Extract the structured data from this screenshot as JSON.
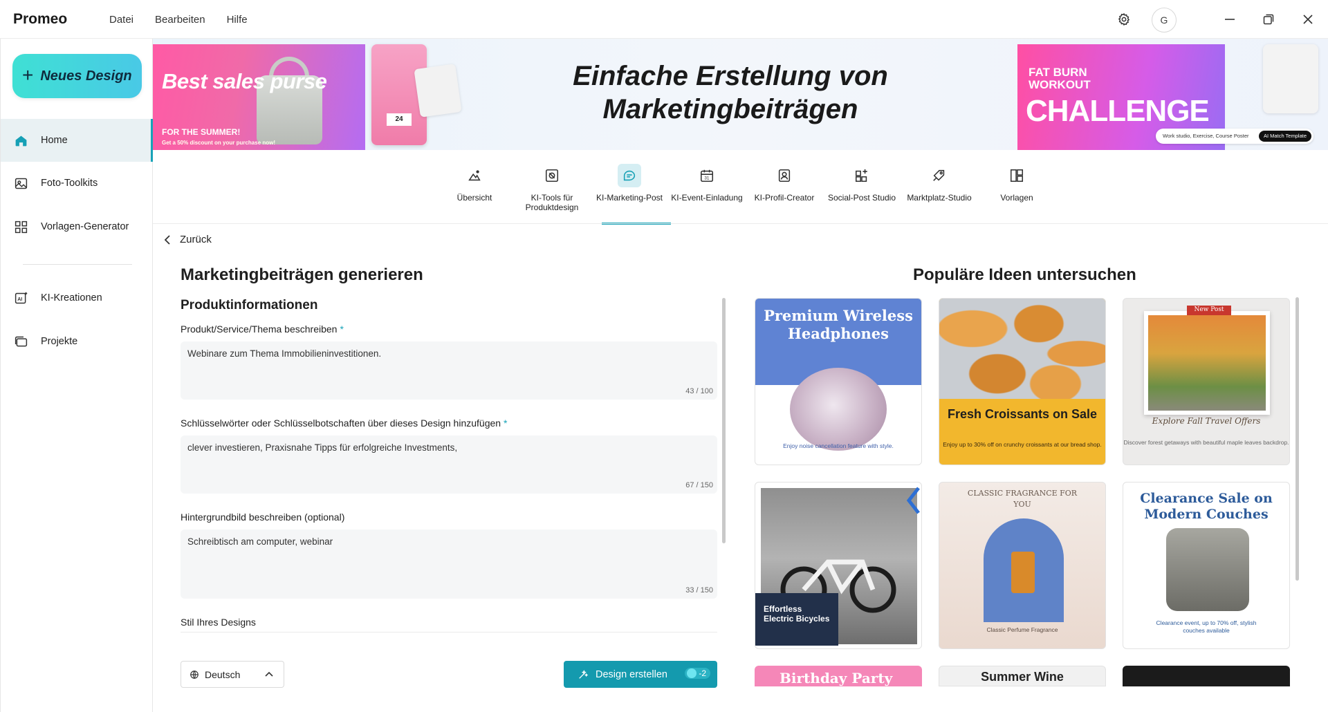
{
  "app": {
    "name": "Promeo"
  },
  "menu": [
    "Datei",
    "Bearbeiten",
    "Hilfe"
  ],
  "user": {
    "initial": "G"
  },
  "sidebar": {
    "new_design": "Neues Design",
    "items": [
      {
        "label": "Home",
        "icon": "home-icon",
        "active": true
      },
      {
        "label": "Foto-Toolkits",
        "icon": "image-icon"
      },
      {
        "label": "Vorlagen-Generator",
        "icon": "grid-icon"
      },
      {
        "label": "KI-Kreationen",
        "icon": "ai-image-icon"
      },
      {
        "label": "Projekte",
        "icon": "folder-icon"
      }
    ]
  },
  "banner": {
    "title_line1": "Einfache Erstellung von",
    "title_line2": "Marketingbeiträgen",
    "left_promo": {
      "headline": "Best sales purse",
      "sub": "FOR THE SUMMER!",
      "note": "Get a 50% discount on your purchase now!",
      "date": "24"
    },
    "right_promo": {
      "line1": "FAT BURN",
      "line2": "WORKOUT",
      "headline": "CHALLENGE",
      "tags": "Work studio, Exercise, Course Poster",
      "button": "AI Match Template"
    }
  },
  "tabs": [
    {
      "label": "Übersicht",
      "icon": "overview-icon"
    },
    {
      "label": "KI-Tools für Produktdesign",
      "icon": "product-design-icon"
    },
    {
      "label": "KI-Marketing-Post",
      "icon": "marketing-post-icon",
      "active": true
    },
    {
      "label": "KI-Event-Einladung",
      "icon": "calendar-icon"
    },
    {
      "label": "KI-Profil-Creator",
      "icon": "profile-icon"
    },
    {
      "label": "Social-Post Studio",
      "icon": "social-post-icon"
    },
    {
      "label": "Marktplatz-Studio",
      "icon": "marketplace-icon"
    },
    {
      "label": "Vorlagen",
      "icon": "templates-icon"
    }
  ],
  "back": "Zurück",
  "form": {
    "title": "Marketingbeiträgen generieren",
    "section": "Produktinformationen",
    "fields": [
      {
        "label": "Produkt/Service/Thema beschreiben",
        "required": "*",
        "value": "Webinare zum Thema Immobilieninvestitionen.",
        "count": "43 / 100"
      },
      {
        "label": "Schlüsselwörter oder Schlüsselbotschaften über dieses Design hinzufügen",
        "required": "*",
        "value": "clever investieren, Praxisnahe Tipps für erfolgreiche Investments,",
        "count": "67 / 150"
      },
      {
        "label": "Hintergrundbild beschreiben (optional)",
        "value": "Schreibtisch am computer, webinar",
        "count": "33 / 150"
      }
    ],
    "style_label": "Stil Ihres Designs",
    "language": "Deutsch",
    "create_button": "Design erstellen",
    "credit": "-2"
  },
  "popular": {
    "title": "Populäre Ideen untersuchen",
    "cards": [
      {
        "title": "Premium Wireless Headphones",
        "caption": "Enjoy noise cancellation feature with style."
      },
      {
        "title": "Fresh Croissants on Sale",
        "caption": "Enjoy up to 30% off on crunchy croissants at our bread shop."
      },
      {
        "tag": "New Post",
        "title": "Explore Fall Travel Offers",
        "caption": "Discover forest getaways with beautiful maple leaves backdrop."
      },
      {
        "title": "Effortless Electric Bicycles"
      },
      {
        "title": "CLASSIC FRAGRANCE FOR YOU",
        "caption": "Classic Perfume Fragrance"
      },
      {
        "title": "Clearance Sale on Modern Couches",
        "caption": "Clearance event, up to 70% off, stylish couches available"
      },
      {
        "title": "Birthday Party"
      },
      {
        "title": "Summer Wine"
      },
      {
        "title": ""
      }
    ]
  },
  "colors": {
    "accent": "#17a3b8",
    "button": "#149aae"
  }
}
